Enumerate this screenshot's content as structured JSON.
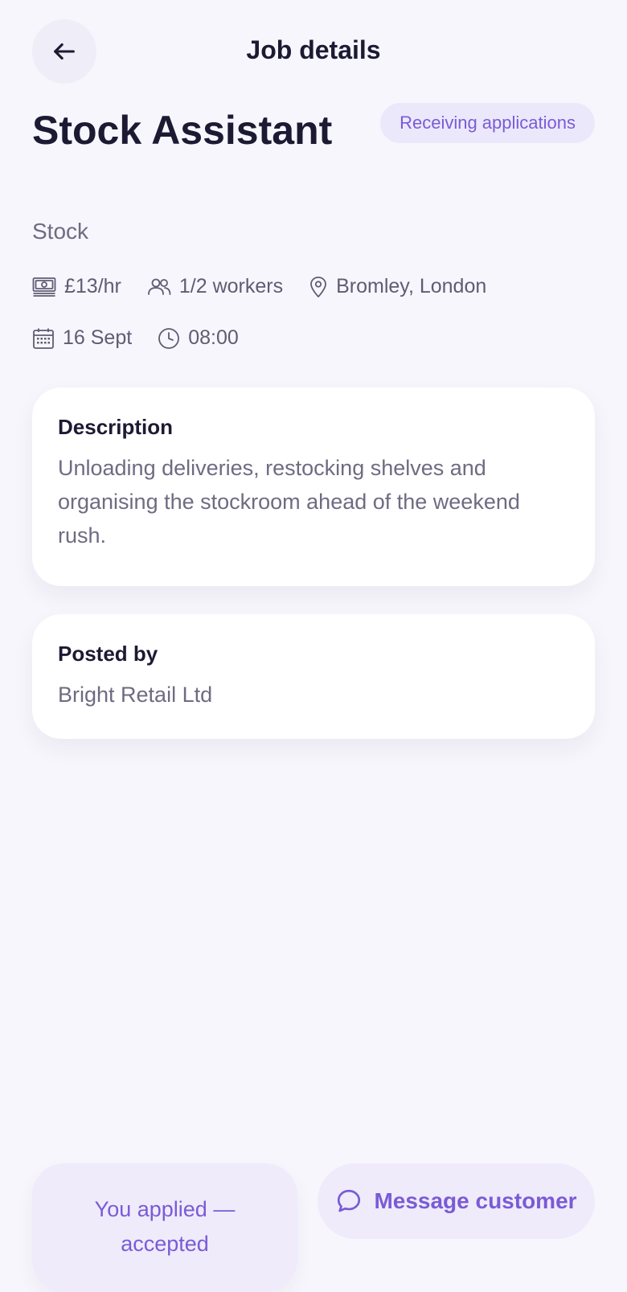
{
  "header": {
    "title": "Job details",
    "back_icon": "arrow-left-icon"
  },
  "job": {
    "title": "Stock Assistant",
    "category": "Stock",
    "status": "Receiving applications",
    "pay": "£13/hr",
    "workers": "1/2 workers",
    "location": "Bromley, London",
    "date": "16 Sept",
    "time": "08:00"
  },
  "icons": {
    "pay": "banknote-icon",
    "workers": "users-icon",
    "location": "map-pin-icon",
    "date": "calendar-icon",
    "time": "clock-icon",
    "message": "chat-bubble-icon"
  },
  "description": {
    "heading": "Description",
    "body": "Unloading deliveries, restocking shelves and organising the stockroom ahead of the weekend rush."
  },
  "posted_by": {
    "heading": "Posted by",
    "name": "Bright Retail Ltd"
  },
  "actions": {
    "applied_label": "You applied — accepted",
    "message_label": "Message customer"
  },
  "colors": {
    "accent": "#7a5bd6",
    "background": "#f7f6fc",
    "badge_bg": "#ece8fb",
    "text_primary": "#1c1a33",
    "text_secondary": "#6e6b82"
  }
}
